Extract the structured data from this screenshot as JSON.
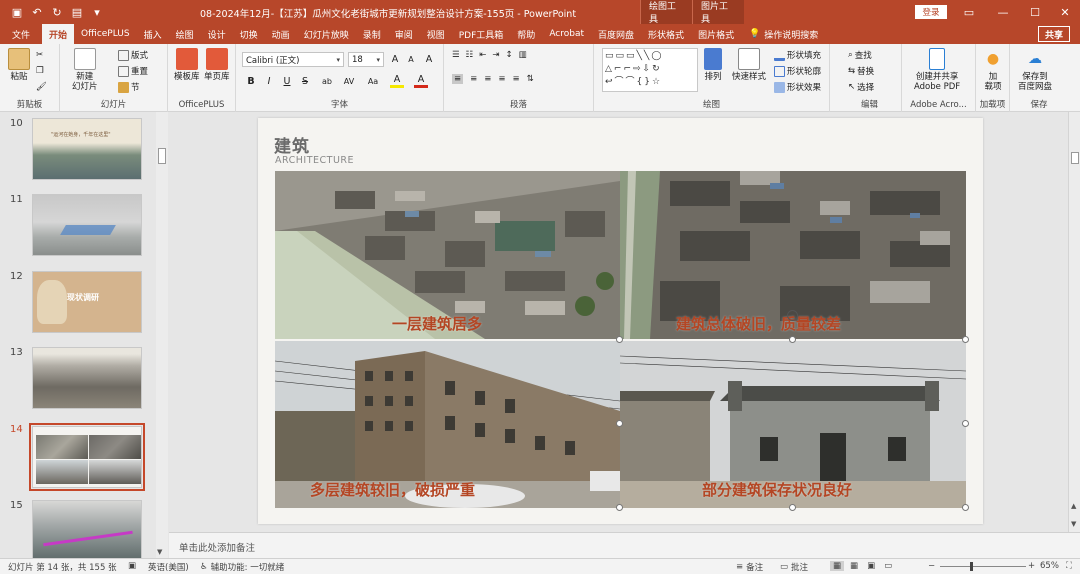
{
  "titlebar": {
    "doc_title": "08-2024年12月-【江苏】瓜州文化老街城市更新规划整治设计方案-155页  -  PowerPoint",
    "ctx_picture_tools": "绘图工具",
    "ctx_image_tools": "图片工具",
    "login": "登录",
    "autosave_icon": "save-icon"
  },
  "tabs": [
    "文件",
    "开始",
    "OfficePLUS",
    "插入",
    "绘图",
    "设计",
    "切换",
    "动画",
    "幻灯片放映",
    "录制",
    "审阅",
    "视图",
    "PDF工具箱",
    "帮助",
    "Acrobat",
    "百度网盘",
    "形状格式",
    "图片格式"
  ],
  "active_tab": "开始",
  "tell_me": "操作说明搜索",
  "share": "共享",
  "ribbon": {
    "clipboard": {
      "paste": "粘贴",
      "label": "剪贴板"
    },
    "slides": {
      "new_slide": "新建\n幻灯片",
      "layout": "版式",
      "reset": "重置",
      "section": "节",
      "label": "幻灯片"
    },
    "officeplus": {
      "template": "模板库",
      "single": "单页库",
      "label": "OfficePLUS"
    },
    "font": {
      "family": "Calibri (正文)",
      "size": "18",
      "label": "字体",
      "bold": "B",
      "italic": "I",
      "underline": "U",
      "strike": "S",
      "shadow": "ab",
      "spacing": "AV",
      "case": "Aa",
      "grow": "A",
      "shrink": "A",
      "clear": "A",
      "highlight": "A",
      "color": "A"
    },
    "paragraph": {
      "label": "段落"
    },
    "drawing": {
      "arrange": "排列",
      "quick_styles": "快速样式",
      "fill": "形状填充",
      "outline": "形状轮廓",
      "effects": "形状效果",
      "label": "绘图"
    },
    "editing": {
      "find": "查找",
      "replace": "替换",
      "select": "选择",
      "label": "编辑"
    },
    "adobe": {
      "create": "创建并共享\nAdobe PDF",
      "label": "Adobe Acro..."
    },
    "addins": {
      "addin": "加\n载项",
      "label": "加载项"
    },
    "save": {
      "save_baidu": "保存到\n百度网盘",
      "label": "保存"
    }
  },
  "thumbnails": [
    {
      "num": "10",
      "title": "\"运河在她身，千年在这里\""
    },
    {
      "num": "11",
      "title": ""
    },
    {
      "num": "12",
      "title": "现状调研"
    },
    {
      "num": "13",
      "title": ""
    },
    {
      "num": "14",
      "title": ""
    },
    {
      "num": "15",
      "title": ""
    }
  ],
  "slide": {
    "title": "建筑",
    "subtitle": "ARCHITECTURE",
    "captions": [
      "一层建筑居多",
      "建筑总体破旧，质量较差",
      "多层建筑较旧，破损严重",
      "部分建筑保存状况良好"
    ]
  },
  "notes_placeholder": "单击此处添加备注",
  "status": {
    "slide_count": "幻灯片 第 14 张，共 155 张",
    "language": "英语(美国)",
    "accessibility": "辅助功能: 一切就绪",
    "notes": "备注",
    "comments": "批注",
    "zoom": "65%"
  },
  "colors": {
    "accent": "#b7472a",
    "caption": "#b44624"
  }
}
